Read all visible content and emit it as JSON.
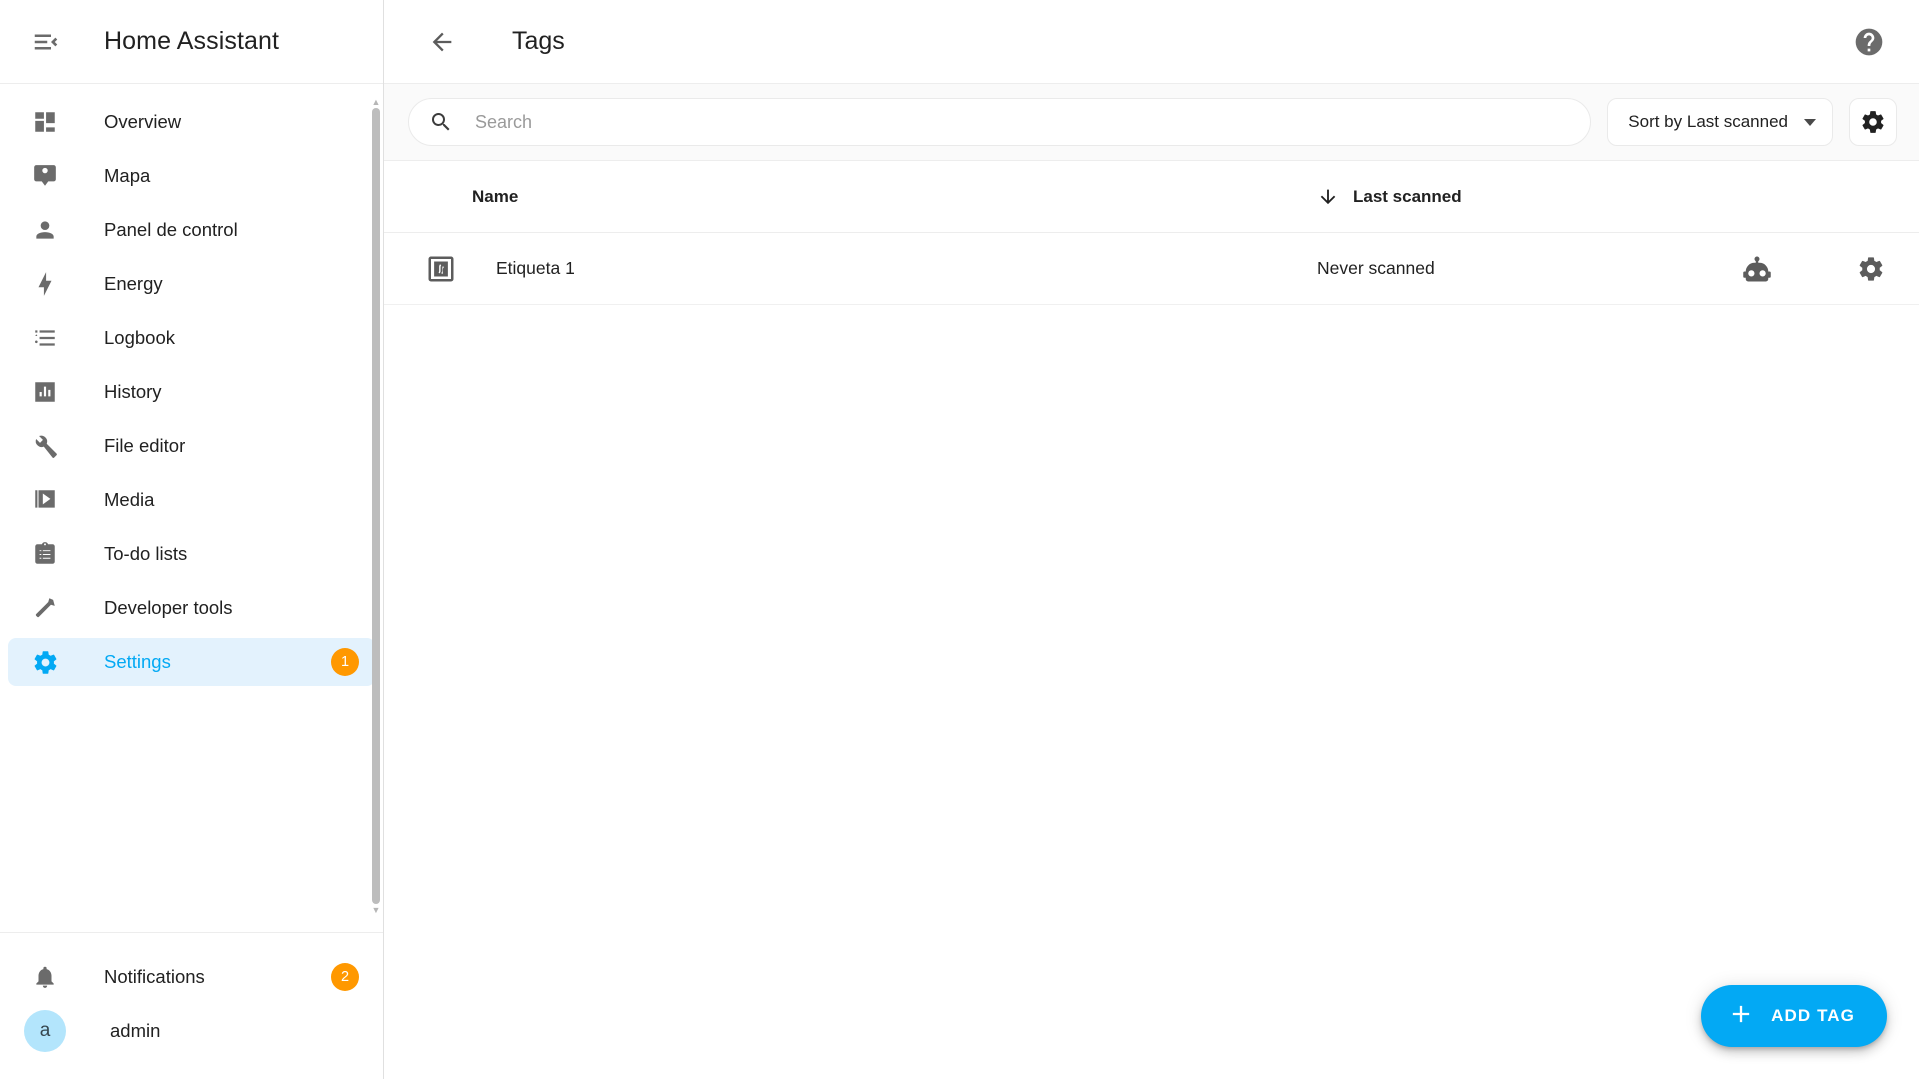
{
  "sidebar": {
    "menu_icon": "menu-collapse-icon",
    "title": "Home Assistant",
    "items": [
      {
        "label": "Overview",
        "icon": "view-dashboard-icon",
        "badge": null,
        "selected": false
      },
      {
        "label": "Mapa",
        "icon": "map-marker-account-icon",
        "badge": null,
        "selected": false
      },
      {
        "label": "Panel de control",
        "icon": "account-icon",
        "badge": null,
        "selected": false
      },
      {
        "label": "Energy",
        "icon": "lightning-bolt-icon",
        "badge": null,
        "selected": false
      },
      {
        "label": "Logbook",
        "icon": "format-list-bulleted-icon",
        "badge": null,
        "selected": false
      },
      {
        "label": "History",
        "icon": "chart-box-icon",
        "badge": null,
        "selected": false
      },
      {
        "label": "File editor",
        "icon": "wrench-icon",
        "badge": null,
        "selected": false
      },
      {
        "label": "Media",
        "icon": "multimedia-icon",
        "badge": null,
        "selected": false
      },
      {
        "label": "To-do lists",
        "icon": "clipboard-list-icon",
        "badge": null,
        "selected": false
      },
      {
        "label": "Developer tools",
        "icon": "hammer-icon",
        "badge": null,
        "selected": false
      },
      {
        "label": "Settings",
        "icon": "cog-icon",
        "badge": "1",
        "selected": true
      }
    ],
    "bottom_items": [
      {
        "label": "Notifications",
        "icon": "bell-icon",
        "badge": "2"
      },
      {
        "label": "admin",
        "icon": "avatar",
        "avatar_letter": "a",
        "badge": null
      }
    ]
  },
  "header": {
    "back_icon": "arrow-left-icon",
    "title": "Tags",
    "help_icon": "help-circle-icon"
  },
  "toolbar": {
    "search_icon": "search-icon",
    "search_value": "",
    "search_placeholder": "Search",
    "sort_label": "Sort by Last scanned",
    "sort_caret_icon": "chevron-down-icon",
    "settings_icon": "gear-icon"
  },
  "table": {
    "columns": [
      {
        "key": "name",
        "label": "Name",
        "sorted": false
      },
      {
        "key": "last_scanned",
        "label": "Last scanned",
        "sorted": true,
        "sort_icon": "arrow-down-icon"
      }
    ],
    "rows": [
      {
        "icon": "nfc-tag-icon",
        "name": "Etiqueta 1",
        "last_scanned": "Never scanned",
        "actions": [
          {
            "icon": "robot-icon",
            "name": "create-automation"
          },
          {
            "icon": "gear-icon",
            "name": "tag-settings"
          }
        ]
      }
    ]
  },
  "fab": {
    "icon": "plus-icon",
    "label": "ADD TAG"
  },
  "colors": {
    "accent": "#03a9f4",
    "badge": "#ff9800",
    "selected_bg": "#e3f2fd",
    "avatar_bg": "#b3e5fc",
    "toolbar_bg": "#fafafa"
  }
}
